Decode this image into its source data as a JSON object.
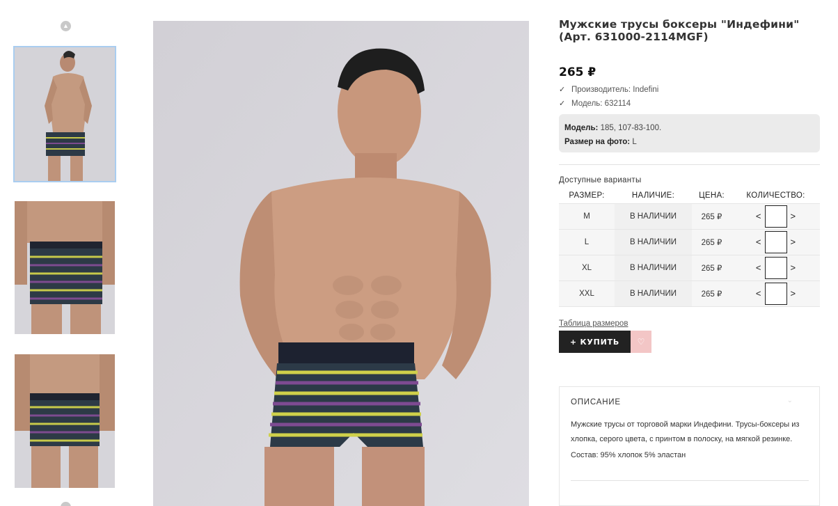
{
  "product": {
    "title": "Мужские трусы боксеры \"Индефини\" (Арт. 631000-2114MGF)",
    "price": "265 ₽",
    "manufacturer": "Производитель: Indefini",
    "model": "Модель: 632114",
    "model_box": {
      "model_label": "Модель:",
      "model_value": "185, 107-83-100.",
      "size_label": "Размер на фото:",
      "size_value": "L"
    }
  },
  "variants": {
    "label": "Доступные варианты",
    "headers": [
      "РАЗМЕР:",
      "НАЛИЧИЕ:",
      "ЦЕНА:",
      "КОЛИЧЕСТВО:"
    ],
    "rows": [
      {
        "size": "M",
        "availability": "В НАЛИЧИИ",
        "price": "265 ₽",
        "dec": "<",
        "inc": ">"
      },
      {
        "size": "L",
        "availability": "В НАЛИЧИИ",
        "price": "265 ₽",
        "dec": "<",
        "inc": ">"
      },
      {
        "size": "XL",
        "availability": "В НАЛИЧИИ",
        "price": "265 ₽",
        "dec": "<",
        "inc": ">"
      },
      {
        "size": "XXL",
        "availability": "В НАЛИЧИИ",
        "price": "265 ₽",
        "dec": "<",
        "inc": ">"
      }
    ]
  },
  "actions": {
    "size_table_link": "Таблица размеров",
    "buy_label": "+ КУПИТЬ"
  },
  "description": {
    "heading": "ОПИСАНИЕ",
    "text": "Мужские трусы от торговой марки Индефини. Трусы-боксеры из хлопка, серого цвета, с принтом в полоску, на мягкой резинке.",
    "composition": "Состав: 95% хлопок 5% эластан"
  },
  "icons": {
    "thumb_up": "chevron-up-icon",
    "check": "check-icon",
    "favorite": "heart-icon",
    "collapse": "chevron-down-icon"
  },
  "colors": {
    "buy_button": "#222222",
    "favorite_button": "#f3c6c6",
    "thumb_active_border": "#a9cdf0"
  }
}
